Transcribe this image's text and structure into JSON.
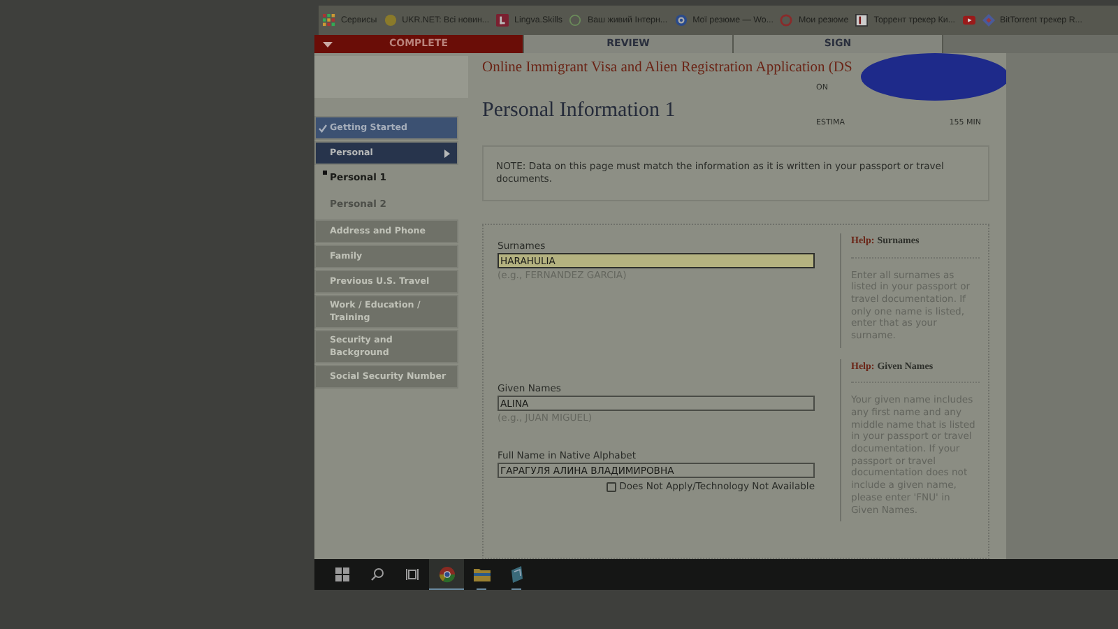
{
  "bookmarks": [
    {
      "kind": "apps",
      "label": "Сервисы"
    },
    {
      "kind": "ukrnet",
      "label": "UKR.NET: Всі новин..."
    },
    {
      "kind": "lingva",
      "label": "Lingva.Skills"
    },
    {
      "kind": "globe",
      "label": "Ваш живий Інтерн..."
    },
    {
      "kind": "target",
      "label": "Мої резюме — Wo..."
    },
    {
      "kind": "ring",
      "label": "Мои резюме"
    },
    {
      "kind": "torrent",
      "label": "Торрент трекер Ки..."
    },
    {
      "kind": "video"
    },
    {
      "kind": "bittorrent",
      "label": "BitTorrent трекер R..."
    }
  ],
  "steps": [
    {
      "label": "COMPLETE",
      "selected": true
    },
    {
      "label": "REVIEW",
      "selected": false
    },
    {
      "label": "SIGN",
      "selected": false
    }
  ],
  "app_title": "Online Immigrant Visa and Alien Registration Application (DS",
  "sidebar": [
    {
      "label": "Getting Started",
      "kind": "completed"
    },
    {
      "label": "Personal",
      "kind": "current",
      "children": [
        {
          "label": "Personal 1",
          "selected": true
        },
        {
          "label": "Personal 2",
          "selected": false
        }
      ]
    },
    {
      "label": "Address and Phone",
      "kind": "locked"
    },
    {
      "label": "Family",
      "kind": "locked"
    },
    {
      "label": "Previous U.S. Travel",
      "kind": "locked"
    },
    {
      "label": "Work / Education / Training",
      "kind": "locked"
    },
    {
      "label": "Security and Background",
      "kind": "locked"
    },
    {
      "label": "Social Security Number",
      "kind": "locked"
    }
  ],
  "page_heading": "Personal Information 1",
  "status_info": {
    "line_1": "ON",
    "line_3_label": "ESTIMA",
    "line_3_value": "155 MIN"
  },
  "note": "NOTE: Data on this page must match the information as it is written in your passport or travel documents.",
  "fields": [
    {
      "label": "Surnames",
      "value": "HARAHULIA",
      "hint": "(e.g., FERNANDEZ GARCIA)",
      "focused": true
    },
    {
      "label": "Given Names",
      "value": "ALINA",
      "hint": "(e.g., JUAN MIGUEL)",
      "focused": false
    },
    {
      "label": "Full Name in Native Alphabet",
      "value": "ГАРАГУЛЯ АЛИНА ВЛАДИМИРОВНА",
      "focused": false,
      "checkbox": {
        "label": "Does Not Apply/Technology Not Available",
        "checked": false
      }
    }
  ],
  "help": [
    {
      "prefix": "Help:",
      "title": "Surnames",
      "text": "Enter all surnames as listed in your passport or travel documentation. If only one name is listed, enter that as your surname."
    },
    {
      "prefix": "Help:",
      "title": "Given Names",
      "text": "Your given name includes any first name and any middle name that is listed in your passport or travel documentation. If your passport or travel documentation does not include a given name, please enter 'FNU' in Given Names."
    }
  ],
  "taskbar": [
    {
      "kind": "start",
      "selected": false,
      "running": false
    },
    {
      "kind": "search",
      "selected": false,
      "running": false
    },
    {
      "kind": "task-view",
      "selected": false,
      "running": false
    },
    {
      "kind": "browser",
      "selected": true,
      "running": true
    },
    {
      "kind": "folder",
      "selected": false,
      "running": true
    },
    {
      "kind": "app",
      "selected": false,
      "running": true
    }
  ]
}
